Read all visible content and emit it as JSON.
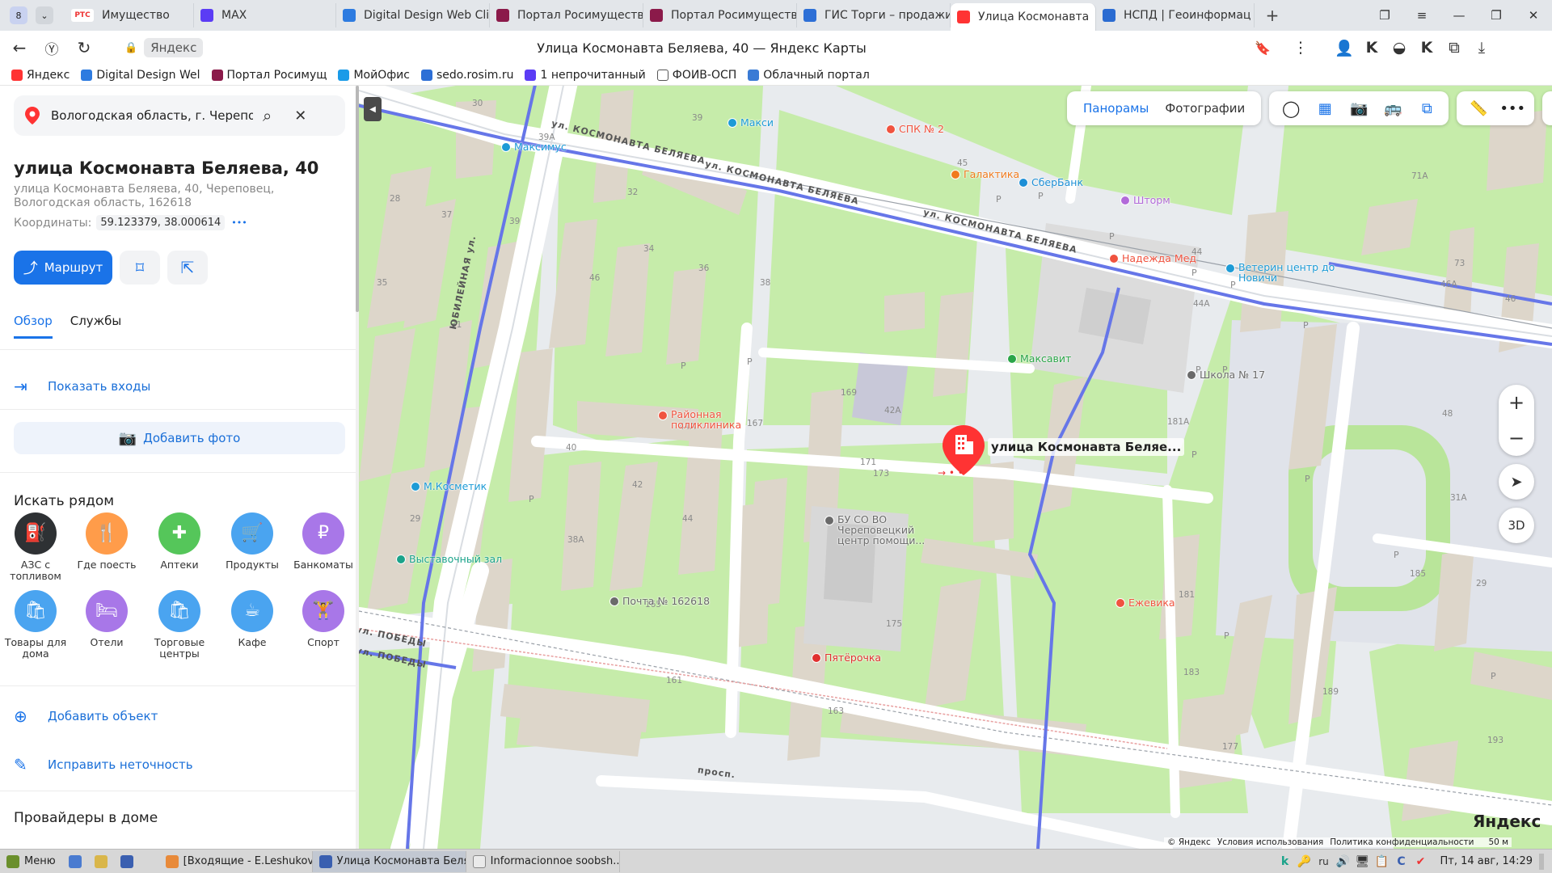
{
  "browser": {
    "tab_counter": "8",
    "tabs": [
      {
        "label": "Имущество",
        "fav_text": "РТС",
        "fav_color": "#ffffff"
      },
      {
        "label": "MAX",
        "fav_color": "#5b3cf5"
      },
      {
        "label": "Digital Design Web Clie",
        "fav_color": "#2d7be0"
      },
      {
        "label": "Портал Росимуществ",
        "fav_color": "#8b1a4a"
      },
      {
        "label": "Портал Росимуществ",
        "fav_color": "#8b1a4a"
      },
      {
        "label": "ГИС Торги – продажи",
        "fav_color": "#2d6fd6"
      },
      {
        "label": "Улица Космонавта",
        "fav_color": "#f33"
      },
      {
        "label": "НСПД | Геоинформац",
        "fav_color": "#2a6bd1"
      }
    ],
    "active_tab_index": 6,
    "new_tab": "+",
    "url_badge": "Яндекс",
    "page_title": "Улица Космонавта Беляева, 40 — Яндекс Карты",
    "bookmarks": [
      {
        "label": "Яндекс",
        "color": "#f33"
      },
      {
        "label": "Digital Design Wel",
        "color": "#2d7be0"
      },
      {
        "label": "Портал Росимущ",
        "color": "#8b1a4a"
      },
      {
        "label": "МойОфис",
        "color": "#1a9be8"
      },
      {
        "label": "sedo.rosim.ru",
        "color": "#2d6fd6"
      },
      {
        "label": "1 непрочитанный",
        "color": "#5b3cf5"
      },
      {
        "label": "ФОИВ-ОСП",
        "color": "#ffffff"
      },
      {
        "label": "Облачный портал",
        "color": "#3a7bd5"
      }
    ]
  },
  "panel": {
    "search_value": "Вологодская область, г. Череповец, у",
    "title": "улица Космонавта Беляева, 40",
    "address": "улица Космонавта Беляева, 40, Череповец, Вологодская область, 162618",
    "coords_label": "Координаты:",
    "coords_value": "59.123379, 38.000614",
    "coords_more": "•••",
    "route_label": "Маршрут",
    "tabs": [
      "Обзор",
      "Службы"
    ],
    "show_entrances": "Показать входы",
    "add_photo": "Добавить фото",
    "nearby_header": "Искать рядом",
    "categories": [
      {
        "label": "АЗС с топливом",
        "color": "#2e3134",
        "glyph": "⛽"
      },
      {
        "label": "Где поесть",
        "color": "#ff9c4a",
        "glyph": "🍴"
      },
      {
        "label": "Аптеки",
        "color": "#55c65a",
        "glyph": "✚"
      },
      {
        "label": "Продукты",
        "color": "#4aa4f0",
        "glyph": "🛒"
      },
      {
        "label": "Банкоматы",
        "color": "#a877e8",
        "glyph": "₽"
      },
      {
        "label": "Товары для дома",
        "color": "#4aa4f0",
        "glyph": "🛍"
      },
      {
        "label": "Отели",
        "color": "#a877e8",
        "glyph": "🛏"
      },
      {
        "label": "Торговые центры",
        "color": "#4aa4f0",
        "glyph": "🛍"
      },
      {
        "label": "Кафе",
        "color": "#4aa4f0",
        "glyph": "☕"
      },
      {
        "label": "Спорт",
        "color": "#a877e8",
        "glyph": "🏋"
      }
    ],
    "add_object": "Добавить объект",
    "fix_error": "Исправить неточность",
    "providers_header": "Провайдеры в доме"
  },
  "map": {
    "top_buttons": [
      "Панорамы",
      "Фотографии"
    ],
    "marker_label": "улица Космонавта Беляе...",
    "zoom_in": "+",
    "zoom_out": "−",
    "btn_3d": "3D",
    "brand": "Яндекс",
    "footer_links": [
      "© Яндекс",
      "Условия использования",
      "Политика конфиденциальности"
    ],
    "scale": "50 м",
    "colors": {
      "road": "#ffffff",
      "green": "#c6ecaa",
      "building": "#ddd8d0",
      "border": "#6676e8"
    },
    "streets": [
      {
        "label": "ул. КОСМОНАВТА БЕЛЯЕВА"
      },
      {
        "label": "ул. КОСМОНАВТА БЕЛЯЕВА"
      },
      {
        "label": "ул. КОСМОНАВТА БЕЛЯЕВА"
      },
      {
        "label": "ЮБИЛЕЙНАЯ ул."
      },
      {
        "label": "ул. ПОБЕДЫ"
      },
      {
        "label": "ул. ПОБЕДЫ"
      },
      {
        "label": "просп."
      }
    ],
    "pois": [
      {
        "label": "Макси",
        "color": "#1d9bd6"
      },
      {
        "label": "Максимус",
        "color": "#1d9bd6"
      },
      {
        "label": "СПК № 2",
        "color": "#f0533f"
      },
      {
        "label": "Галактика",
        "color": "#f07a1e"
      },
      {
        "label": "СберБанк",
        "color": "#1d8fd6"
      },
      {
        "label": "Шторм",
        "color": "#b26ad9"
      },
      {
        "label": "Надежда Мед",
        "color": "#f0533f"
      },
      {
        "label": "Ветерин центр до Новичи",
        "color": "#1d9bd6"
      },
      {
        "label": "Максавит",
        "color": "#2aa548"
      },
      {
        "label": "Школа № 17",
        "color": "#6a6a6a"
      },
      {
        "label": "Районная поликлиника",
        "color": "#f0533f"
      },
      {
        "label": "М.Косметик",
        "color": "#1d9bd6"
      },
      {
        "label": "Выставочный зал",
        "color": "#1aa38a"
      },
      {
        "label": "БУ СО ВО Череповецкий центр помощи...",
        "color": "#6a6a6a"
      },
      {
        "label": "Почта № 162618",
        "color": "#6a6a6a"
      },
      {
        "label": "Ежевика",
        "color": "#f0533f"
      },
      {
        "label": "Пятёрочка",
        "color": "#e0302e"
      }
    ],
    "house_numbers": [
      "30",
      "39А",
      "39",
      "45",
      "28",
      "37",
      "39",
      "32",
      "71А",
      "35",
      "46",
      "34",
      "36",
      "38",
      "44",
      "31",
      "44А",
      "73",
      "46А",
      "46",
      "44А",
      "40",
      "42",
      "169",
      "42А",
      "181А",
      "29",
      "38А",
      "44",
      "167",
      "171",
      "48",
      "173",
      "165",
      "175",
      "181",
      "31А",
      "185",
      "161",
      "183",
      "189",
      "29",
      "163",
      "177",
      "193"
    ]
  },
  "taskbar": {
    "menu": "Меню",
    "windows": [
      {
        "label": "[Входящие - E.Leshukov...",
        "color": "#e88a3a"
      },
      {
        "label": "Улица Космонавта Беля...",
        "color": "#3a5fb0"
      },
      {
        "label": "Informacionnoe soobsh...",
        "color": "#eaeaea"
      }
    ],
    "lang": "ru",
    "clock": "Пт, 14 авг, 14:29"
  }
}
